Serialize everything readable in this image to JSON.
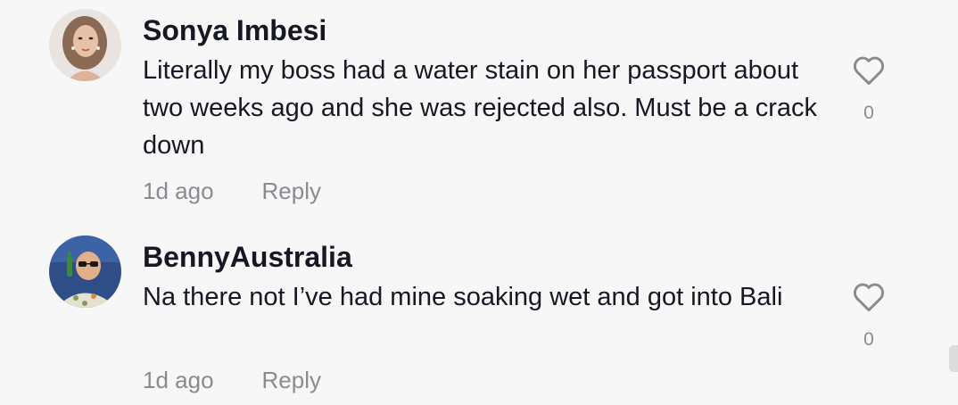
{
  "comments": [
    {
      "username": "Sonya Imbesi",
      "text": "Literally my boss had a water stain on her passport about two weeks ago and she was rejected also. Must be a crack down",
      "time": "1d ago",
      "reply_label": "Reply",
      "like_count": "0",
      "like_icon": "heart-outline-icon"
    },
    {
      "username": "BennyAustralia",
      "text": "Na there not I’ve had mine soaking wet and got into Bali",
      "time": "1d ago",
      "reply_label": "Reply",
      "like_count": "0",
      "like_icon": "heart-outline-icon"
    }
  ],
  "colors": {
    "background": "#f7f7f7",
    "text_primary": "#161823",
    "text_secondary": "#8a8b91",
    "icon": "#8a8b91"
  }
}
